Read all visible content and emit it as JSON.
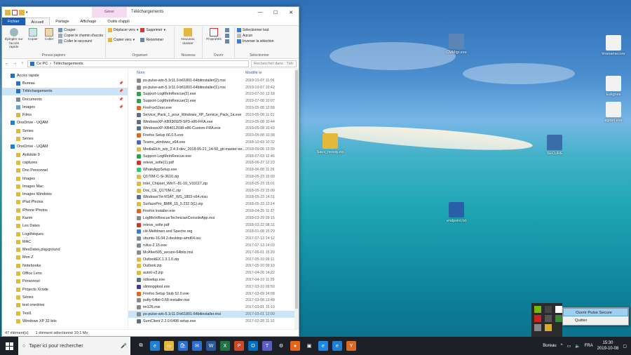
{
  "window": {
    "title": "Téléchargements",
    "context_tab": "Gérer",
    "close_glyph": "✕",
    "min_glyph": "—",
    "max_glyph": "☐"
  },
  "ribbon": {
    "tabs": [
      "Fichier",
      "Accueil",
      "Partage",
      "Affichage",
      "Outils d'appli"
    ],
    "clipboard": {
      "pin": "Épingler sur l'accès rapide",
      "copy": "Copier",
      "paste": "Coller",
      "cut": "Couper",
      "copy_path": "Copier le chemin d'accès",
      "paste_shortcut": "Coller le raccourci",
      "label": "Presse-papiers"
    },
    "organize": {
      "move": "Déplacer vers",
      "copy_to": "Copier vers",
      "delete": "Supprimer",
      "rename": "Renommer",
      "label": "Organiser"
    },
    "new": {
      "folder": "Nouveau dossier",
      "label": "Nouveau"
    },
    "open": {
      "props": "Propriétés",
      "label": "Ouvrir"
    },
    "select": {
      "all": "Sélectionner tout",
      "none": "Aucun",
      "invert": "Inverser la sélection",
      "label": "Sélectionner"
    }
  },
  "address": {
    "crumbs": [
      "Ce PC",
      "Téléchargements"
    ],
    "search_placeholder": "Rechercher dans : Téléchargements",
    "back": "←",
    "forward": "→",
    "up": "↑"
  },
  "nav": [
    {
      "label": "Accès rapide",
      "color": "#1a73c8",
      "pin": ""
    },
    {
      "label": "Bureau",
      "color": "#2a6fd0",
      "pin": "📌"
    },
    {
      "label": "Téléchargements",
      "color": "#2a6fd0",
      "pin": "📌",
      "sel": true
    },
    {
      "label": "Documents",
      "color": "#7f8a99",
      "pin": "📌"
    },
    {
      "label": "Images",
      "color": "#6ba0d8",
      "pin": "📌"
    },
    {
      "label": "Films",
      "color": "#d8b34a",
      "pin": ""
    },
    {
      "label": "OneDrive - UQAM",
      "color": "#1e7fd8",
      "pin": ""
    },
    {
      "label": "Series",
      "color": "#e2b93b",
      "pin": ""
    },
    {
      "label": "Séries",
      "color": "#e2b93b",
      "pin": ""
    },
    {
      "label": "OneDrive - UQAM",
      "color": "#1e7fd8",
      "pin": ""
    },
    {
      "label": "Antidote 9",
      "color": "#e2b93b",
      "pin": ""
    },
    {
      "label": "captures",
      "color": "#e2b93b",
      "pin": ""
    },
    {
      "label": "Doc Personnel",
      "color": "#e2b93b",
      "pin": ""
    },
    {
      "label": "Images",
      "color": "#e2b93b",
      "pin": ""
    },
    {
      "label": "Images Mac",
      "color": "#e2b93b",
      "pin": ""
    },
    {
      "label": "Images Windows",
      "color": "#e2b93b",
      "pin": ""
    },
    {
      "label": "iPad Photos",
      "color": "#e2b93b",
      "pin": ""
    },
    {
      "label": "iPhone Photos",
      "color": "#e2b93b",
      "pin": ""
    },
    {
      "label": "Karim",
      "color": "#e2b93b",
      "pin": ""
    },
    {
      "label": "Les Dates",
      "color": "#e2b93b",
      "pin": ""
    },
    {
      "label": "Logithèques",
      "color": "#e2b93b",
      "pin": ""
    },
    {
      "label": "MAC",
      "color": "#e2b93b",
      "pin": ""
    },
    {
      "label": "MesDates.playground",
      "color": "#e2b93b",
      "pin": ""
    },
    {
      "label": "Mon Z",
      "color": "#e2b93b",
      "pin": ""
    },
    {
      "label": "Notebooks",
      "color": "#e2b93b",
      "pin": ""
    },
    {
      "label": "Office Lens",
      "color": "#e2b93b",
      "pin": ""
    },
    {
      "label": "Personnel",
      "color": "#e2b93b",
      "pin": ""
    },
    {
      "label": "Projects Xcode",
      "color": "#e2b93b",
      "pin": ""
    },
    {
      "label": "Séries",
      "color": "#e2b93b",
      "pin": ""
    },
    {
      "label": "test onedrive",
      "color": "#e2b93b",
      "pin": ""
    },
    {
      "label": "Test1",
      "color": "#e2b93b",
      "pin": ""
    },
    {
      "label": "Windows XP 32 bits",
      "color": "#e2b93b",
      "pin": ""
    }
  ],
  "columns": {
    "name": "Nom",
    "date": "Modifié le"
  },
  "files": [
    {
      "name": "ps-pulse-win-5.1r11.0-b61801-64bitinstaller(2).msi",
      "date": "2019-10-07 11:06",
      "color": "#8a8a8a"
    },
    {
      "name": "ps-pulse-win-5.1r11.0-b61801-64bitinstaller(1).msi",
      "date": "2019-10-07 10:42",
      "color": "#8a8a8a"
    },
    {
      "name": "Support-LogMeInRescue(2).exe",
      "date": "2019-07-10 13:18",
      "color": "#2aa54a"
    },
    {
      "name": "Support-LogMeInRescue(1).exe",
      "date": "2019-07-08 10:07",
      "color": "#2aa54a"
    },
    {
      "name": "FireFox52esr.exe",
      "date": "2019-05-08 12:58",
      "color": "#e8641a"
    },
    {
      "name": "Service_Pack_1_pour_Windows_XP_Service_Pack_1a.exe",
      "date": "2019-05-08 11:01",
      "color": "#5a6f8a"
    },
    {
      "name": "WindowsXP-KB936929-SP3-x86-FRA.exe",
      "date": "2019-05-08 10:44",
      "color": "#5a6f8a"
    },
    {
      "name": "WindowsXP-KB4012598-x86-Custom-FRA.exe",
      "date": "2019-05-08 10:43",
      "color": "#5a6f8a"
    },
    {
      "name": "Firefox Setup 66.0.5.exe",
      "date": "2019-05-08 10:38",
      "color": "#e8641a"
    },
    {
      "name": "Teams_windows_x64.exe",
      "date": "2018-10-03 10:32",
      "color": "#5a5fc8"
    },
    {
      "name": "MediaElch_win_2.4.3-dev_2018-05-21_14-50_git-master-ee...",
      "date": "2018-09-06 13:39",
      "color": "#e2b93b"
    },
    {
      "name": "Support-LogMeInRescue.exe",
      "date": "2018-07-03 12:46",
      "color": "#2aa54a"
    },
    {
      "name": "releve_sofie(1).pdf",
      "date": "2018-06-27 12:23",
      "color": "#d93025"
    },
    {
      "name": "WhatsAppSetup.exe",
      "date": "2018-06-08 11:26",
      "color": "#25d366"
    },
    {
      "name": "Q170M-C-Si-3610.zip",
      "date": "2018-05-23 15:03",
      "color": "#e2b93b"
    },
    {
      "name": "Intel_Chipset_Win7--81-10_V10117.zip",
      "date": "2018-05-23 15:01",
      "color": "#e2b93b"
    },
    {
      "name": "Doc_CE_Q170M-C.zip",
      "date": "2018-05-23 15:00",
      "color": "#e2b93b"
    },
    {
      "name": "WindowsTH-RSAT_WS_1803-x64.msu",
      "date": "2018-05-23 14:31",
      "color": "#5a6f8a"
    },
    {
      "name": "SurfacePro_BMR_15_5.232.0(1).zip",
      "date": "2018-05-23 12:14",
      "color": "#e2b93b"
    },
    {
      "name": "Firefox Installer.exe",
      "date": "2018-04-25 11:37",
      "color": "#e8641a"
    },
    {
      "name": "LogMeInRescueTechnicianConsoleApp.msi",
      "date": "2018-03-29 09:15",
      "color": "#8a8a8a"
    },
    {
      "name": "releve_sofie.pdf",
      "date": "2018-03-22 08:31",
      "color": "#d93025"
    },
    {
      "name": "clé-Meltdown and Spectre.reg",
      "date": "2018-01-08 15:29",
      "color": "#3a7bd5"
    },
    {
      "name": "ubuntu-16.04.2-desktop-amd64.iso",
      "date": "2017-07-13 14:12",
      "color": "#7f8a99"
    },
    {
      "name": "rufus-2.15.exe",
      "date": "2017-07-13 14:03",
      "color": "#7f8a99"
    },
    {
      "name": "McAfee505_secure-64bits.msi",
      "date": "2017-06-01 15:20",
      "color": "#8a8a8a"
    },
    {
      "name": "OutlookEX 1.3.1.0.zip",
      "date": "2017-05-10 09:11",
      "color": "#e2b93b"
    },
    {
      "name": "Outlook.zip",
      "date": "2017-05-10 09:10",
      "color": "#e2b93b"
    },
    {
      "name": "autoit-v3.zip",
      "date": "2017-04-26 14:22",
      "color": "#e2b93b"
    },
    {
      "name": "xdksetup.exe",
      "date": "2017-04-19 11:39",
      "color": "#5a6f8a"
    },
    {
      "name": "slimtopptool.exe",
      "date": "2017-03-10 09:50",
      "color": "#3a3fa8"
    },
    {
      "name": "Firefox Setup Stub 52.0.exe",
      "date": "2017-03-09 14:08",
      "color": "#e8641a"
    },
    {
      "name": "putty-64bit-0.68-installer.msi",
      "date": "2017-03-08 13:48",
      "color": "#8a8a8a"
    },
    {
      "name": "tm126.msi",
      "date": "2017-03-01 15:10",
      "color": "#8a8a8a"
    },
    {
      "name": "ps-pulse-win-5.1r11.0-b61801-64bitinstaller.msi",
      "date": "2017-03-01 12:00",
      "color": "#8a8a8a",
      "sel": true
    },
    {
      "name": "SumClient 2.2.0.6498 setup.exe",
      "date": "2017-02-28 11:10",
      "color": "#5a6f8a"
    }
  ],
  "status": {
    "count": "47 élément(s)",
    "selection": "1 élément sélectionné 10,1 Mo"
  },
  "desktop": [
    {
      "label": "CMMigr.exe",
      "color": "#5b86b5"
    },
    {
      "label": "tmsnamecore",
      "color": "#f2f2f2"
    },
    {
      "label": "Eslignes",
      "color": "#f2f2f2"
    },
    {
      "label": "sginet.exe",
      "color": "#f2f2f2"
    },
    {
      "label": "Sauv_ressig.zip",
      "color": "#e2b93b"
    },
    {
      "label": "SECURE",
      "color": "#3a6ea8"
    },
    {
      "label": "endpoint.txt",
      "color": "#2a5fa8"
    }
  ],
  "context_menu": {
    "open": "Ouvrir Pulse Secure",
    "quit": "Quitter"
  },
  "taskbar": {
    "search_placeholder": "Taper ici pour rechercher",
    "apps": [
      {
        "name": "task-view",
        "color": "#1d2127",
        "g": "⧉"
      },
      {
        "name": "edge",
        "color": "#1e7fd8",
        "g": "e"
      },
      {
        "name": "explorer",
        "color": "#e2b93b",
        "g": "▭"
      },
      {
        "name": "store",
        "color": "#2a6fd0",
        "g": "🛍"
      },
      {
        "name": "mail",
        "color": "#2a6fd0",
        "g": "✉"
      },
      {
        "name": "word",
        "color": "#2b579a",
        "g": "W"
      },
      {
        "name": "excel",
        "color": "#217346",
        "g": "X"
      },
      {
        "name": "powerpoint",
        "color": "#d24726",
        "g": "P"
      },
      {
        "name": "outlook",
        "color": "#0072c6",
        "g": "O"
      },
      {
        "name": "teams",
        "color": "#5a5fc8",
        "g": "T"
      },
      {
        "name": "settings",
        "color": "#1d2127",
        "g": "⚙"
      },
      {
        "name": "firefox",
        "color": "#e8641a",
        "g": "●"
      },
      {
        "name": "remote",
        "color": "#1d2127",
        "g": "▣"
      },
      {
        "name": "ie",
        "color": "#1e88e5",
        "g": "e"
      },
      {
        "name": "edge2",
        "color": "#1e7fd8",
        "g": "e"
      },
      {
        "name": "tool",
        "color": "#d86a2a",
        "g": "Y"
      }
    ],
    "bureau": "Bureau",
    "lang": "FRA",
    "time": "15:30",
    "date": "2019-10-08"
  }
}
